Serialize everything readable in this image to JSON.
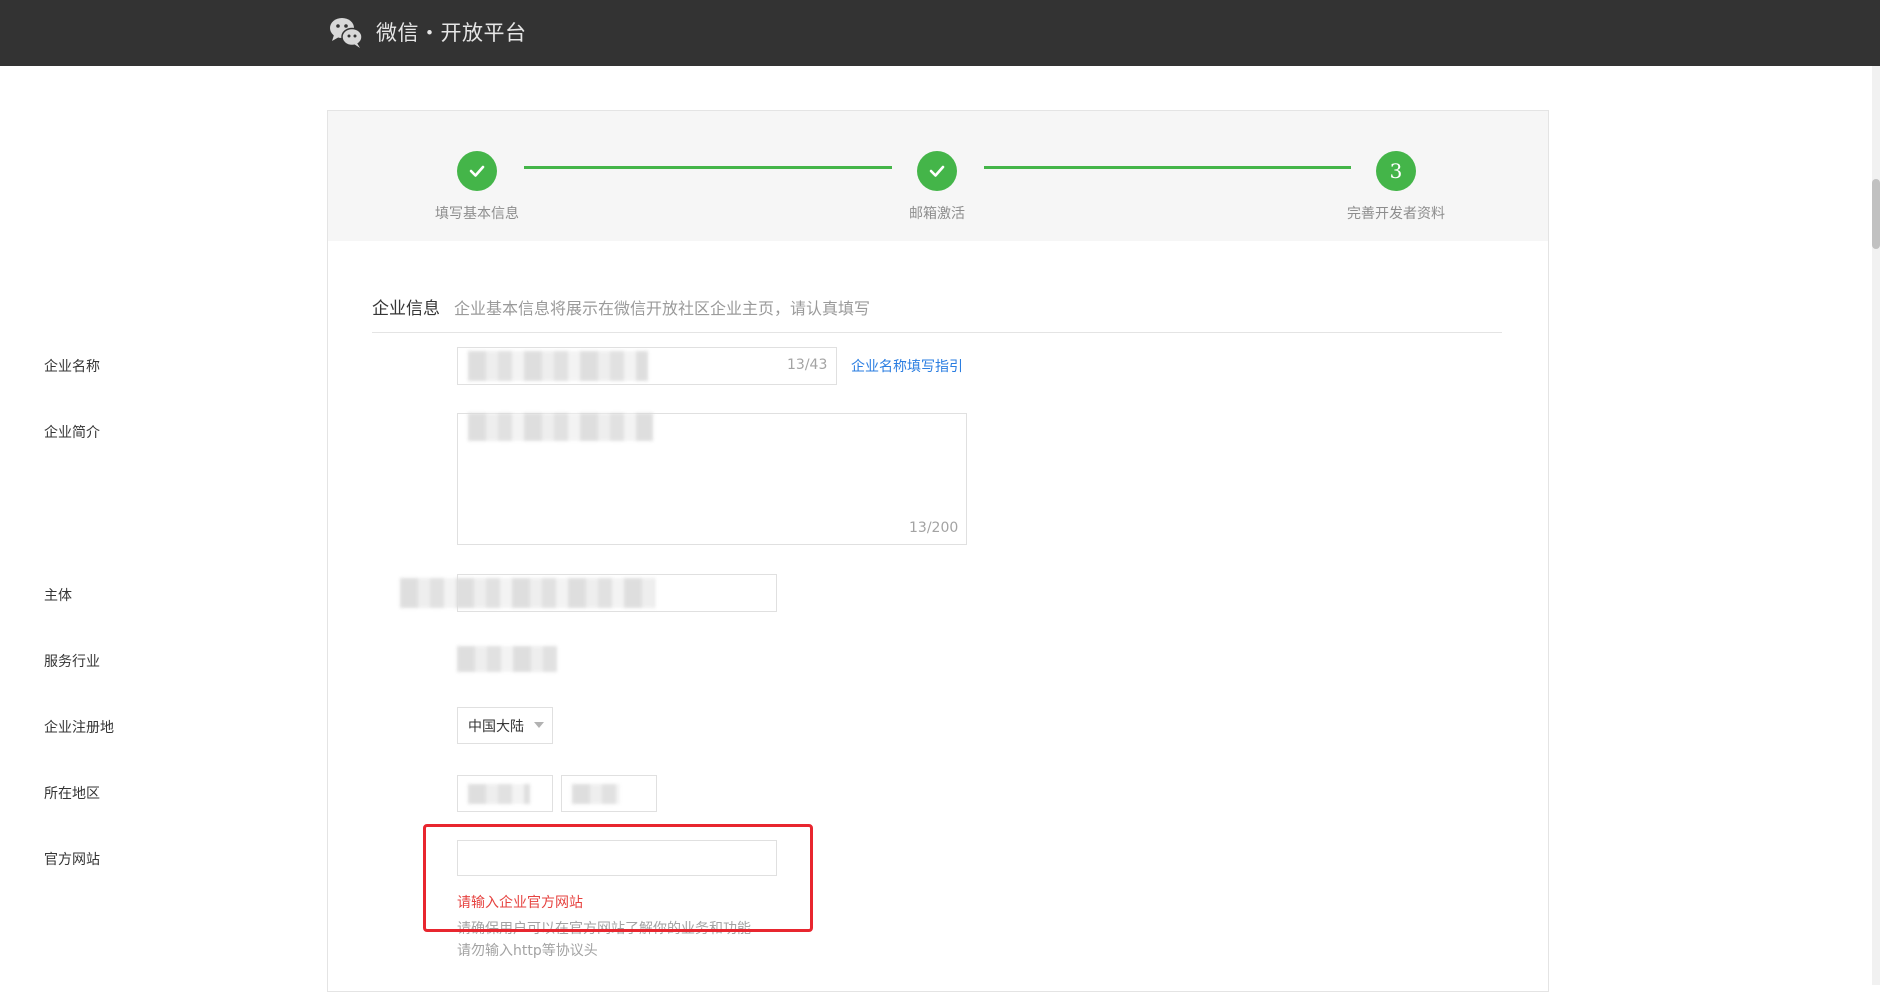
{
  "header": {
    "title": "微信・开放平台",
    "logo_icon": "wechat-icon"
  },
  "steps": [
    {
      "label": "填写基本信息",
      "state": "done"
    },
    {
      "label": "邮箱激活",
      "state": "done"
    },
    {
      "label": "完善开发者资料",
      "number": "3",
      "state": "current"
    }
  ],
  "section": {
    "title": "企业信息",
    "desc": "企业基本信息将展示在微信开放社区企业主页，请认真填写"
  },
  "form": {
    "company_name": {
      "label": "企业名称",
      "counter": "13/43",
      "guide_link": "企业名称填写指引"
    },
    "company_intro": {
      "label": "企业简介",
      "counter": "13/200"
    },
    "main_body": {
      "label": "主体"
    },
    "industry": {
      "label": "服务行业"
    },
    "registration": {
      "label": "企业注册地",
      "value": "中国大陆"
    },
    "region": {
      "label": "所在地区"
    },
    "website": {
      "label": "官方网站",
      "value": "",
      "error": "请输入企业官方网站",
      "tip1": "请确保用户可以在官方网站了解你的业务和功能",
      "tip2": "请勿输入http等协议头"
    }
  },
  "colors": {
    "accent": "#44b549",
    "header_bg": "#333333",
    "error": "#e64340",
    "link": "#2a7de1",
    "highlight": "#e8262f"
  }
}
